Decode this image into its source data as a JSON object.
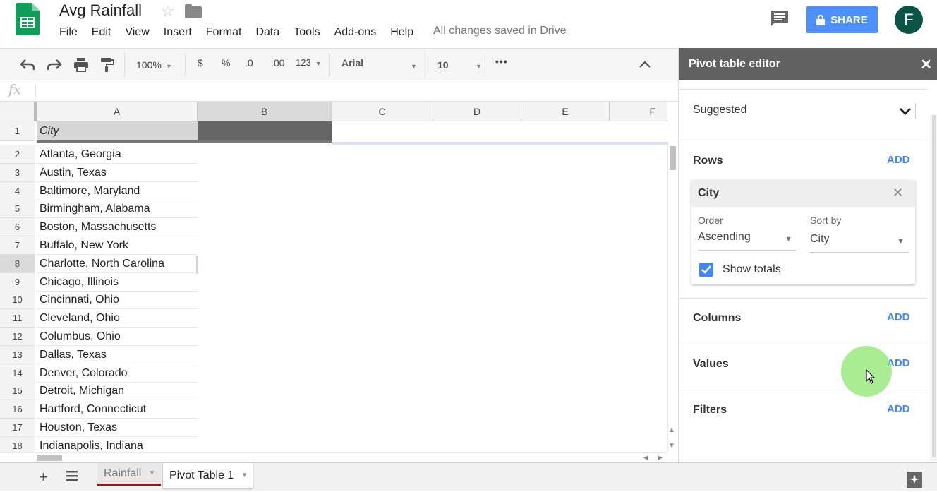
{
  "header": {
    "title": "Avg Rainfall",
    "menu": [
      "File",
      "Edit",
      "View",
      "Insert",
      "Format",
      "Data",
      "Tools",
      "Add-ons",
      "Help"
    ],
    "saved_status": "All changes saved in Drive",
    "share_label": "SHARE",
    "avatar_letter": "F"
  },
  "toolbar": {
    "zoom": "100%",
    "currency": "$",
    "percent": "%",
    "dec_less": ".0",
    "dec_more": ".00",
    "more_formats": "123",
    "font": "Arial",
    "font_size": "10",
    "overflow": "•••"
  },
  "formula_bar": {
    "fx": "fx",
    "value": ""
  },
  "grid": {
    "columns": [
      "A",
      "B",
      "C",
      "D",
      "E",
      "F"
    ],
    "rows": [
      {
        "num": "1",
        "value": "City"
      },
      {
        "num": "2",
        "value": "Atlanta, Georgia"
      },
      {
        "num": "3",
        "value": "Austin, Texas"
      },
      {
        "num": "4",
        "value": "Baltimore, Maryland"
      },
      {
        "num": "5",
        "value": "Birmingham, Alabama"
      },
      {
        "num": "6",
        "value": "Boston, Massachusetts"
      },
      {
        "num": "7",
        "value": "Buffalo, New York"
      },
      {
        "num": "8",
        "value": "Charlotte, North Carolina"
      },
      {
        "num": "9",
        "value": "Chicago, Illinois"
      },
      {
        "num": "10",
        "value": "Cincinnati, Ohio"
      },
      {
        "num": "11",
        "value": "Cleveland, Ohio"
      },
      {
        "num": "12",
        "value": "Columbus, Ohio"
      },
      {
        "num": "13",
        "value": "Dallas, Texas"
      },
      {
        "num": "14",
        "value": "Denver, Colorado"
      },
      {
        "num": "15",
        "value": "Detroit, Michigan"
      },
      {
        "num": "16",
        "value": "Hartford, Connecticut"
      },
      {
        "num": "17",
        "value": "Houston, Texas"
      },
      {
        "num": "18",
        "value": "Indianapolis, Indiana"
      }
    ]
  },
  "sheets": {
    "tabs": [
      "Rainfall",
      "Pivot Table 1"
    ]
  },
  "panel": {
    "title": "Pivot table editor",
    "suggested": "Suggested",
    "rows_label": "Rows",
    "columns_label": "Columns",
    "values_label": "Values",
    "filters_label": "Filters",
    "add_label": "ADD",
    "city_card": {
      "title": "City",
      "order_label": "Order",
      "order_value": "Ascending",
      "sortby_label": "Sort by",
      "sortby_value": "City",
      "show_totals": "Show totals",
      "show_totals_checked": true
    }
  },
  "colors": {
    "accent": "#4285f4",
    "share": "#4d90fe",
    "panel_header": "#616161",
    "avatar": "#0b5345"
  }
}
